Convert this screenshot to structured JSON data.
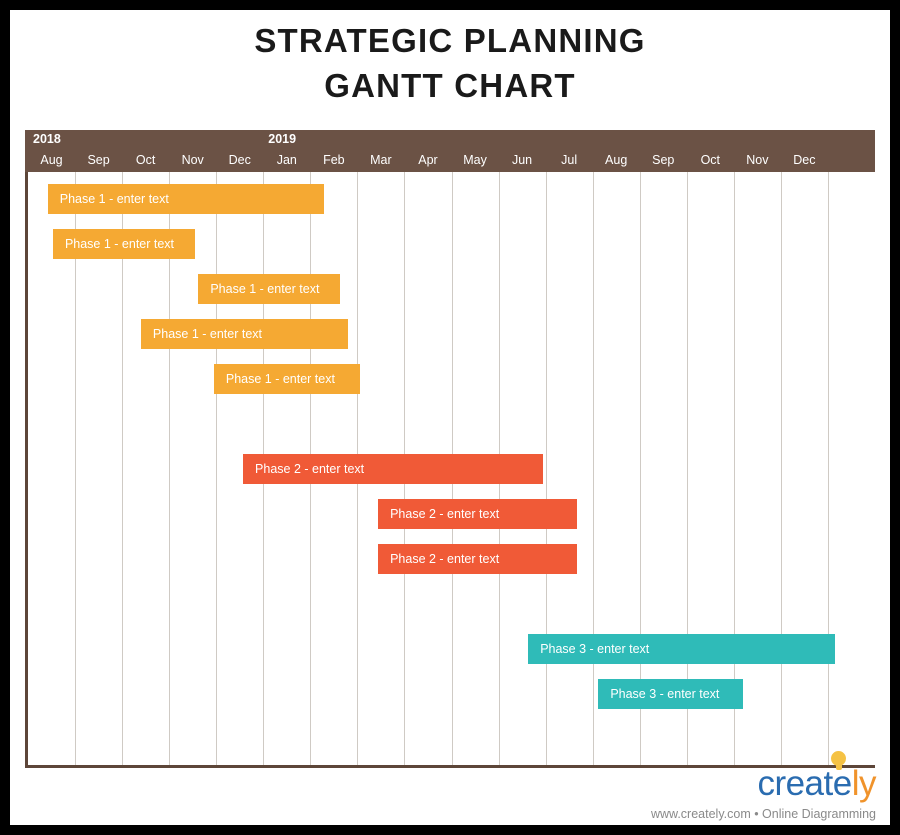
{
  "title": {
    "line1": "STRATEGIC PLANNING",
    "line2": "GANTT CHART"
  },
  "colors": {
    "header_band": "#6b5245",
    "frame": "#5d4639",
    "gridline": "#cfcac4",
    "phase1": "#f5a933",
    "phase2": "#f05a37",
    "phase3": "#2fbbb8",
    "logo_blue": "#2a6cb0",
    "logo_orange": "#f0932b",
    "background": "#ffffff",
    "page_border": "#000000"
  },
  "timeline": {
    "years": [
      {
        "label": "2018",
        "start_month_index": 0
      },
      {
        "label": "2019",
        "start_month_index": 5
      }
    ],
    "months": [
      "Aug",
      "Sep",
      "Oct",
      "Nov",
      "Dec",
      "Jan",
      "Feb",
      "Mar",
      "Apr",
      "May",
      "Jun",
      "Jul",
      "Aug",
      "Sep",
      "Oct",
      "Nov",
      "Dec"
    ],
    "column_count": 18
  },
  "footer": {
    "logo_part1": "creat",
    "logo_part2": "e",
    "logo_part3": "ly",
    "bulb_icon": "lightbulb-icon",
    "tagline": "www.creately.com • Online Diagramming"
  },
  "chart_data": {
    "type": "bar",
    "title": "STRATEGIC PLANNING GANTT CHART",
    "xlabel": "",
    "ylabel": "",
    "orientation": "horizontal",
    "categories": [
      "Aug 2018",
      "Sep 2018",
      "Oct 2018",
      "Nov 2018",
      "Dec 2018",
      "Jan 2019",
      "Feb 2019",
      "Mar 2019",
      "Apr 2019",
      "May 2019",
      "Jun 2019",
      "Jul 2019",
      "Aug 2019",
      "Sep 2019",
      "Oct 2019",
      "Nov 2019",
      "Dec 2019"
    ],
    "grid": true,
    "legend": "none",
    "tasks": [
      {
        "label": "Phase 1 - enter text",
        "phase": "Phase 1",
        "color": "#f5a933",
        "start_month": "Aug 2018",
        "end_month": "Jan 2019",
        "start_col": 0.42,
        "span_cols": 5.87,
        "row": 0
      },
      {
        "label": "Phase 1 - enter text",
        "phase": "Phase 1",
        "color": "#f5a933",
        "start_month": "Sep 2018",
        "end_month": "Nov 2018",
        "start_col": 0.53,
        "span_cols": 3.02,
        "row": 1
      },
      {
        "label": "Phase 1 - enter text",
        "phase": "Phase 1",
        "color": "#f5a933",
        "start_month": "Nov 2018",
        "end_month": "Jan 2019",
        "start_col": 3.62,
        "span_cols": 3.02,
        "row": 2
      },
      {
        "label": "Phase 1 - enter text",
        "phase": "Phase 1",
        "color": "#f5a933",
        "start_month": "Oct 2018",
        "end_month": "Feb 2019",
        "start_col": 2.4,
        "span_cols": 4.4,
        "row": 3
      },
      {
        "label": "Phase 1 - enter text",
        "phase": "Phase 1",
        "color": "#f5a933",
        "start_month": "Nov 2018",
        "end_month": "Feb 2019",
        "start_col": 3.95,
        "span_cols": 3.1,
        "row": 4
      },
      {
        "label": "Phase 2 - enter text",
        "phase": "Phase 2",
        "color": "#f05a37",
        "start_month": "Dec 2018",
        "end_month": "Jun 2019",
        "start_col": 4.57,
        "span_cols": 6.38,
        "row": 6
      },
      {
        "label": "Phase 2 - enter text",
        "phase": "Phase 2",
        "color": "#f05a37",
        "start_month": "Feb 2019",
        "end_month": "Jul 2019",
        "start_col": 7.44,
        "span_cols": 4.23,
        "row": 7
      },
      {
        "label": "Phase 2 - enter text",
        "phase": "Phase 2",
        "color": "#f05a37",
        "start_month": "Feb 2019",
        "end_month": "Jul 2019",
        "start_col": 7.44,
        "span_cols": 4.23,
        "row": 8
      },
      {
        "label": "Phase 3 - enter text",
        "phase": "Phase 3",
        "color": "#2fbbb8",
        "start_month": "Jun 2019",
        "end_month": "Nov 2019",
        "start_col": 10.63,
        "span_cols": 6.52,
        "row": 10
      },
      {
        "label": "Phase 3 - enter text",
        "phase": "Phase 3",
        "color": "#2fbbb8",
        "start_month": "Jul 2019",
        "end_month": "Sep 2019",
        "start_col": 12.12,
        "span_cols": 3.08,
        "row": 11
      }
    ]
  }
}
